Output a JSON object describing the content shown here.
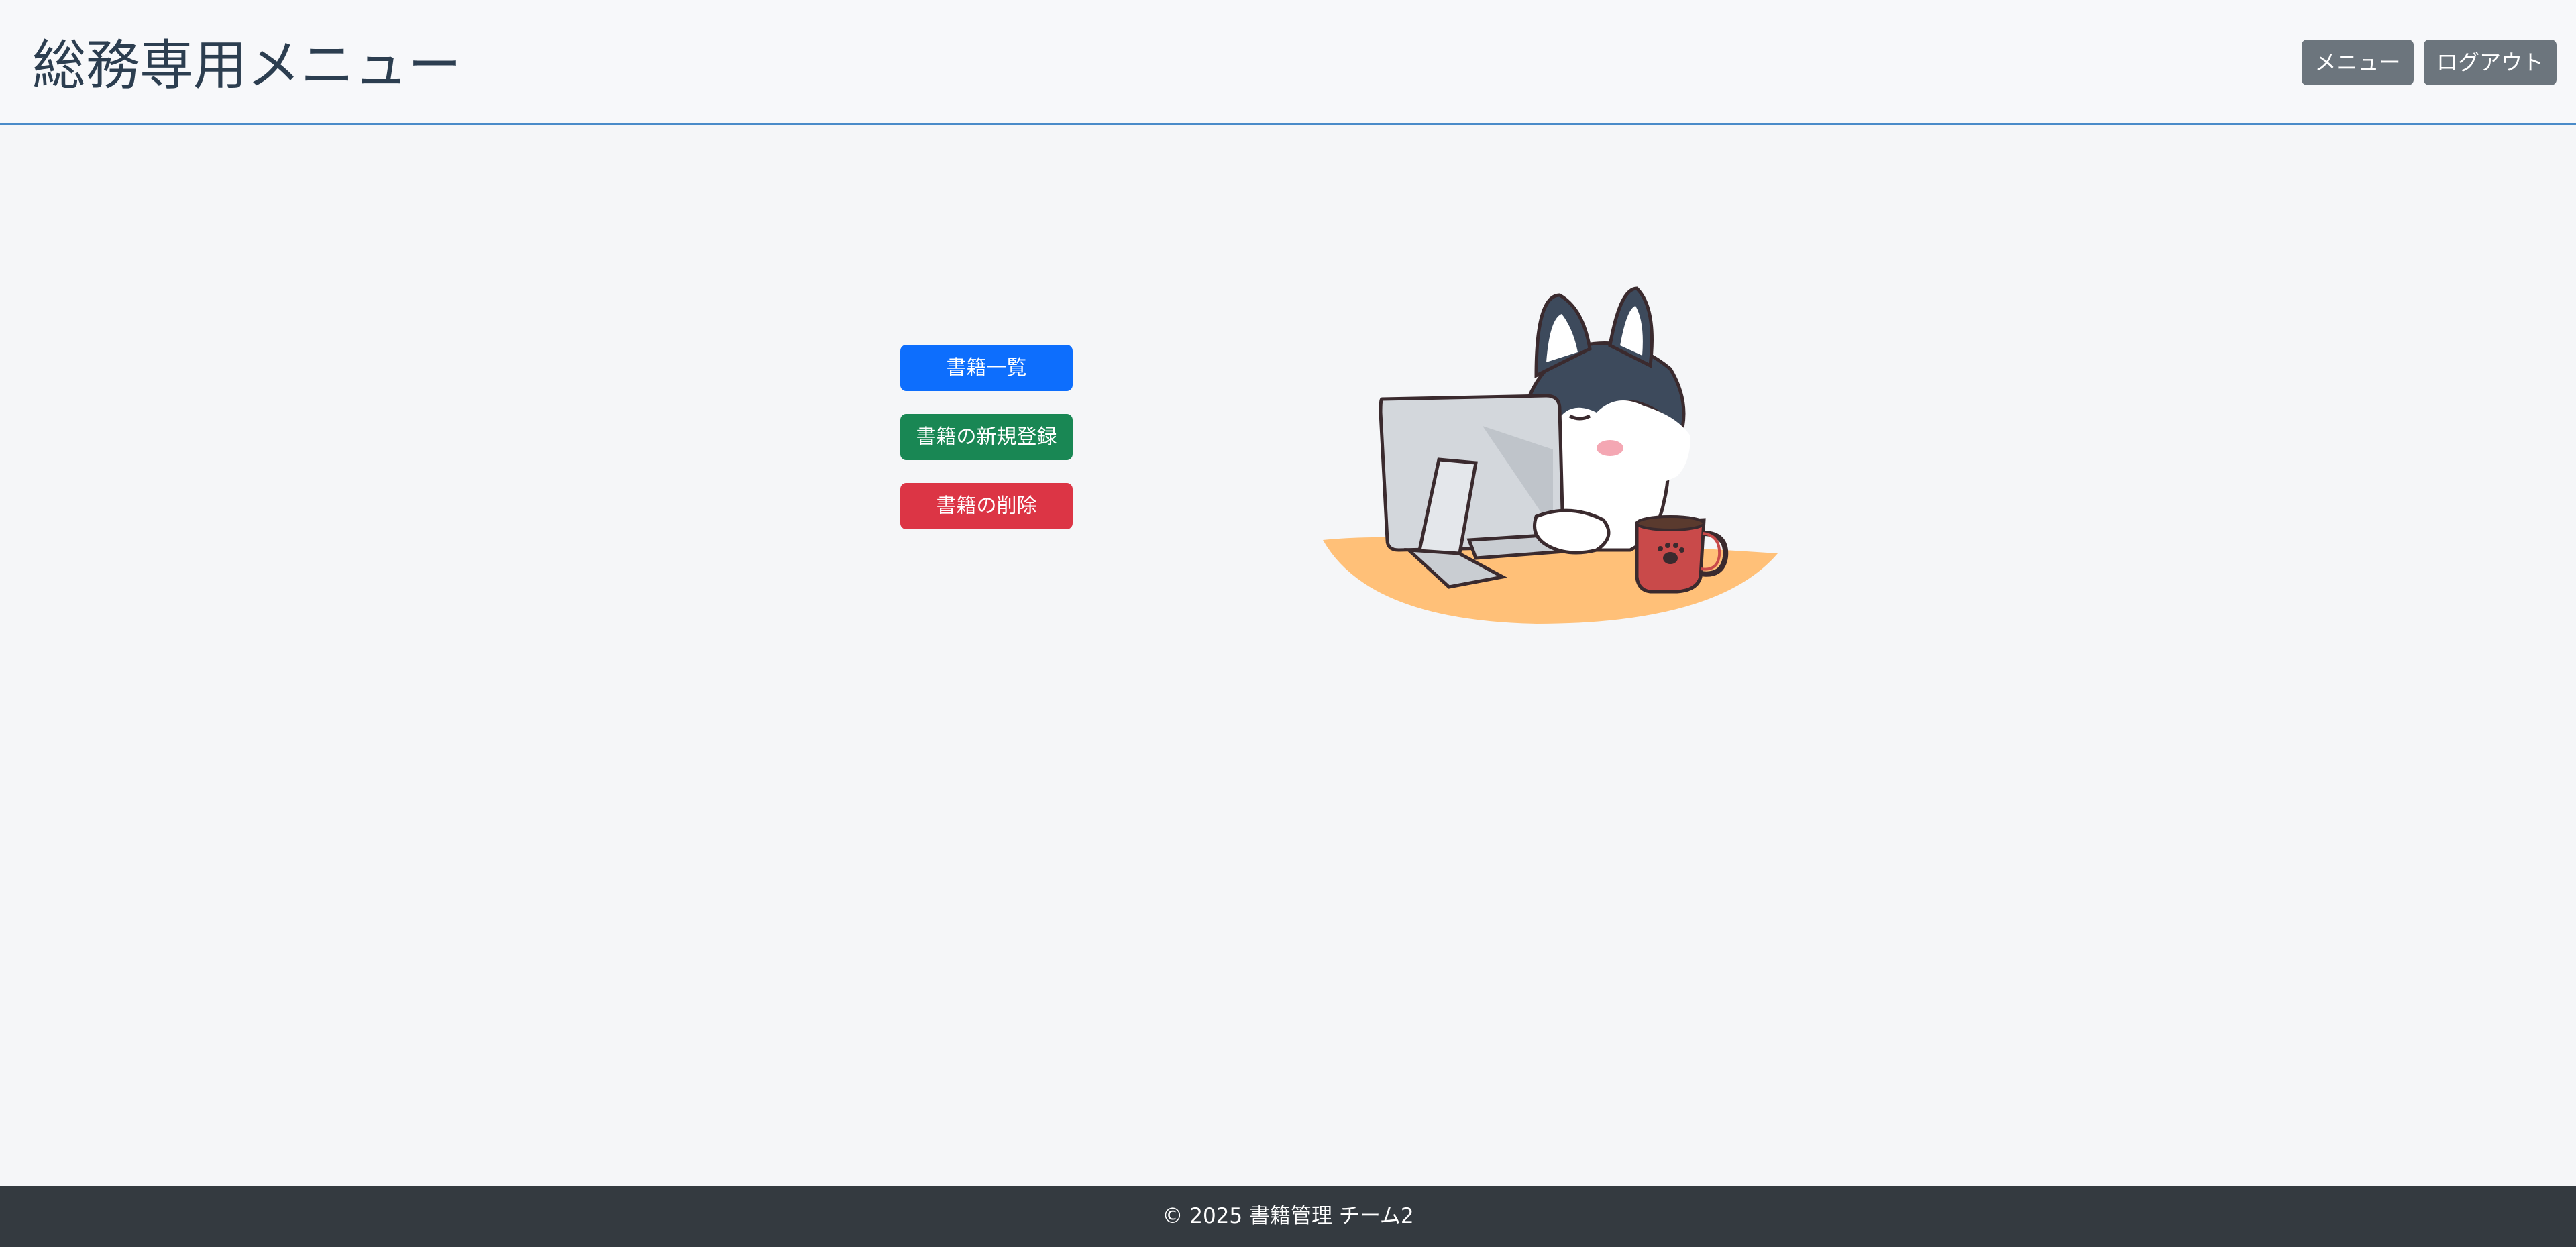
{
  "header": {
    "title": "総務専用メニュー",
    "menu_button": "メニュー",
    "logout_button": "ログアウト"
  },
  "actions": {
    "book_list": "書籍一覧",
    "book_register": "書籍の新規登録",
    "book_delete": "書籍の削除"
  },
  "illustration": {
    "icon": "husky-at-computer-illustration"
  },
  "footer": {
    "copyright": "© 2025 書籍管理 チーム2"
  },
  "colors": {
    "primary": "#0d6efd",
    "success": "#198754",
    "danger": "#dc3545",
    "secondary": "#6c757d",
    "footer_bg": "#343a40",
    "header_border": "#4a8bc9"
  }
}
